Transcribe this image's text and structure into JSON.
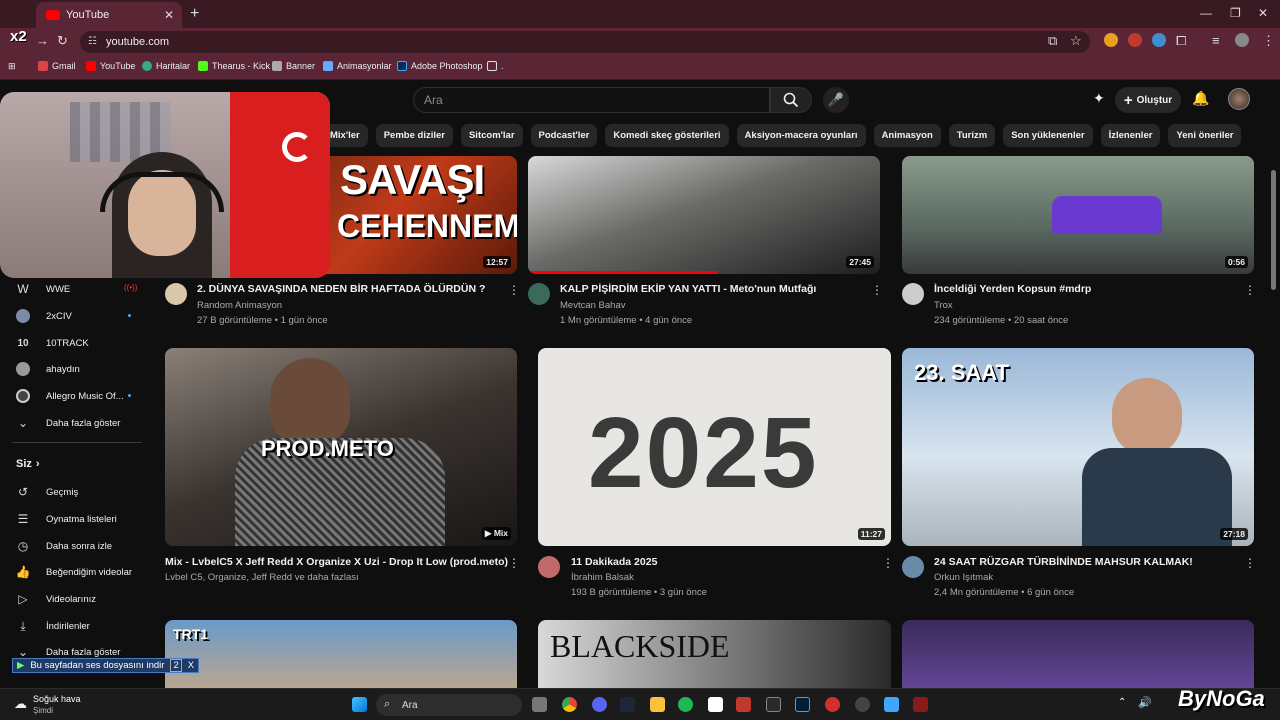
{
  "browser": {
    "tab_title": "YouTube",
    "url": "youtube.com",
    "bookmarks": [
      "Gmail",
      "YouTube",
      "Haritalar",
      "Thearus - Kick",
      "Banner",
      "Animasyonlar",
      "Adobe Photoshop",
      "."
    ]
  },
  "overlay": {
    "brand_tag": "x2"
  },
  "header": {
    "search_placeholder": "Ara",
    "create_label": "Oluştur"
  },
  "chips": [
    "Mix'ler",
    "Pembe diziler",
    "Sitcom'lar",
    "Podcast'ler",
    "Komedi skeç gösterileri",
    "Aksiyon-macera oyunları",
    "Animasyon",
    "Turizm",
    "Son yüklenenler",
    "İzlenenler",
    "Yeni öneriler"
  ],
  "sidebar": {
    "subscriptions": [
      "WWE",
      "2xCIV",
      "10TRACK",
      "ahaydın",
      "Allegro Music Of..."
    ],
    "show_more": "Daha fazla göster",
    "you_header": "Siz",
    "you_items": [
      "Geçmiş",
      "Oynatma listeleri",
      "Daha sonra izle",
      "Beğendiğim videolar",
      "Videolarınız",
      "İndirilenler"
    ],
    "show_more_2": "Daha fazla göster"
  },
  "videos": [
    {
      "title": "2. DÜNYA SAVAŞINDA NEDEN BİR HAFTADA ÖLÜRDÜN ?",
      "channel": "Random Animasyon",
      "meta": "27 B görüntüleme • 1 gün önce",
      "duration": "12:57",
      "thumb_text": "SAVAŞI CEHENNEMİ"
    },
    {
      "title": "KALP PİŞİRDİM EKİP YAN YATTI - Meto'nun Mutfağı",
      "channel": "Mevtcan Bahav",
      "meta": "1 Mn görüntüleme • 4 gün önce",
      "duration": "27:45"
    },
    {
      "title": "İnceldiği Yerden Kopsun #mdrp",
      "channel": "Trox",
      "meta": "234 görüntüleme • 20 saat önce",
      "duration": "0:56"
    },
    {
      "title": "Mix - LvbelC5 X Jeff Redd X Organize X Uzi - Drop It Low (prod.meto)",
      "channel": "Lvbel C5, Organize, Jeff Redd ve daha fazlası",
      "meta": "",
      "duration": "Mix",
      "thumb_text": "PROD.METO"
    },
    {
      "title": "11 Dakikada 2025",
      "channel": "İbrahim Balsak",
      "meta": "193 B görüntüleme • 3 gün önce",
      "duration": "11:27",
      "thumb_text": "2025"
    },
    {
      "title": "24 SAAT RÜZGAR TÜRBİNİNDE MAHSUR KALMAK!",
      "channel": "Orkun Işıtmak",
      "meta": "2,4 Mn görüntüleme • 6 gün önce",
      "duration": "27:18",
      "thumb_text": "23. SAAT"
    }
  ],
  "bottom_thumbs": {
    "t1": "TRT1",
    "t2": "BLACKSIDE"
  },
  "download_bar": {
    "label": "Bu sayfadan ses dosyasını indir",
    "num": "2"
  },
  "taskbar": {
    "weather": "Soğuk hava",
    "weather_sub": "Şimdi",
    "search": "Ara"
  },
  "watermark": "ByNoGa"
}
